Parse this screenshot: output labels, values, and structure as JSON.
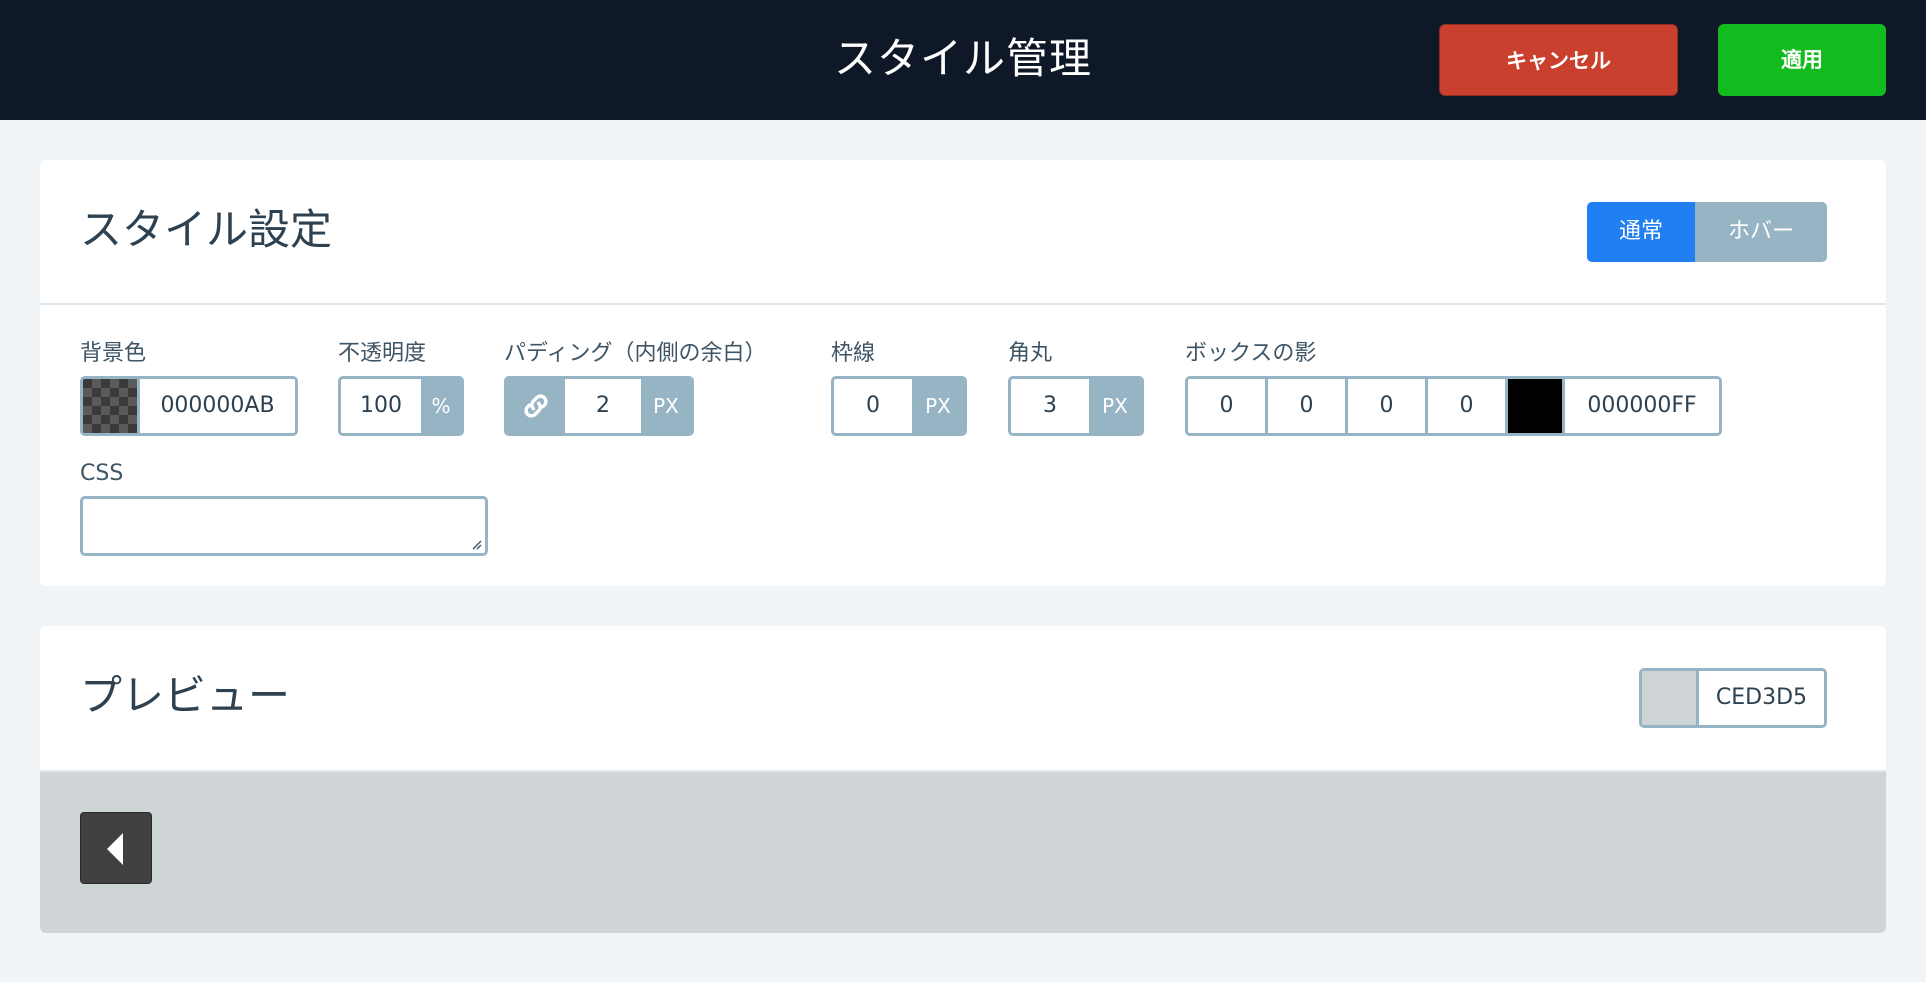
{
  "header": {
    "title": "スタイル管理",
    "cancel_label": "キャンセル",
    "apply_label": "適用"
  },
  "style_panel": {
    "title": "スタイル設定",
    "state_tabs": {
      "normal": "通常",
      "hover": "ホバー",
      "selected": "normal"
    },
    "background": {
      "label": "背景色",
      "value": "000000AB"
    },
    "opacity": {
      "label": "不透明度",
      "value": "100",
      "unit": "%"
    },
    "padding": {
      "label": "パディング（内側の余白）",
      "value": "2",
      "unit": "PX",
      "link_icon": "link-icon"
    },
    "border": {
      "label": "枠線",
      "value": "0",
      "unit": "PX"
    },
    "radius": {
      "label": "角丸",
      "value": "3",
      "unit": "PX"
    },
    "box_shadow": {
      "label": "ボックスの影",
      "values": [
        "0",
        "0",
        "0",
        "0"
      ],
      "color": "000000FF"
    },
    "css": {
      "label": "CSS",
      "value": ""
    }
  },
  "preview_panel": {
    "title": "プレビュー",
    "background_color": "CED3D5",
    "arrow_icon": "caret-left-icon"
  },
  "colors": {
    "topbar": "#0e1826",
    "cancel": "#c9402e",
    "apply": "#12bc1e",
    "accent": "#1f7ff3",
    "border": "#97b4c4"
  }
}
